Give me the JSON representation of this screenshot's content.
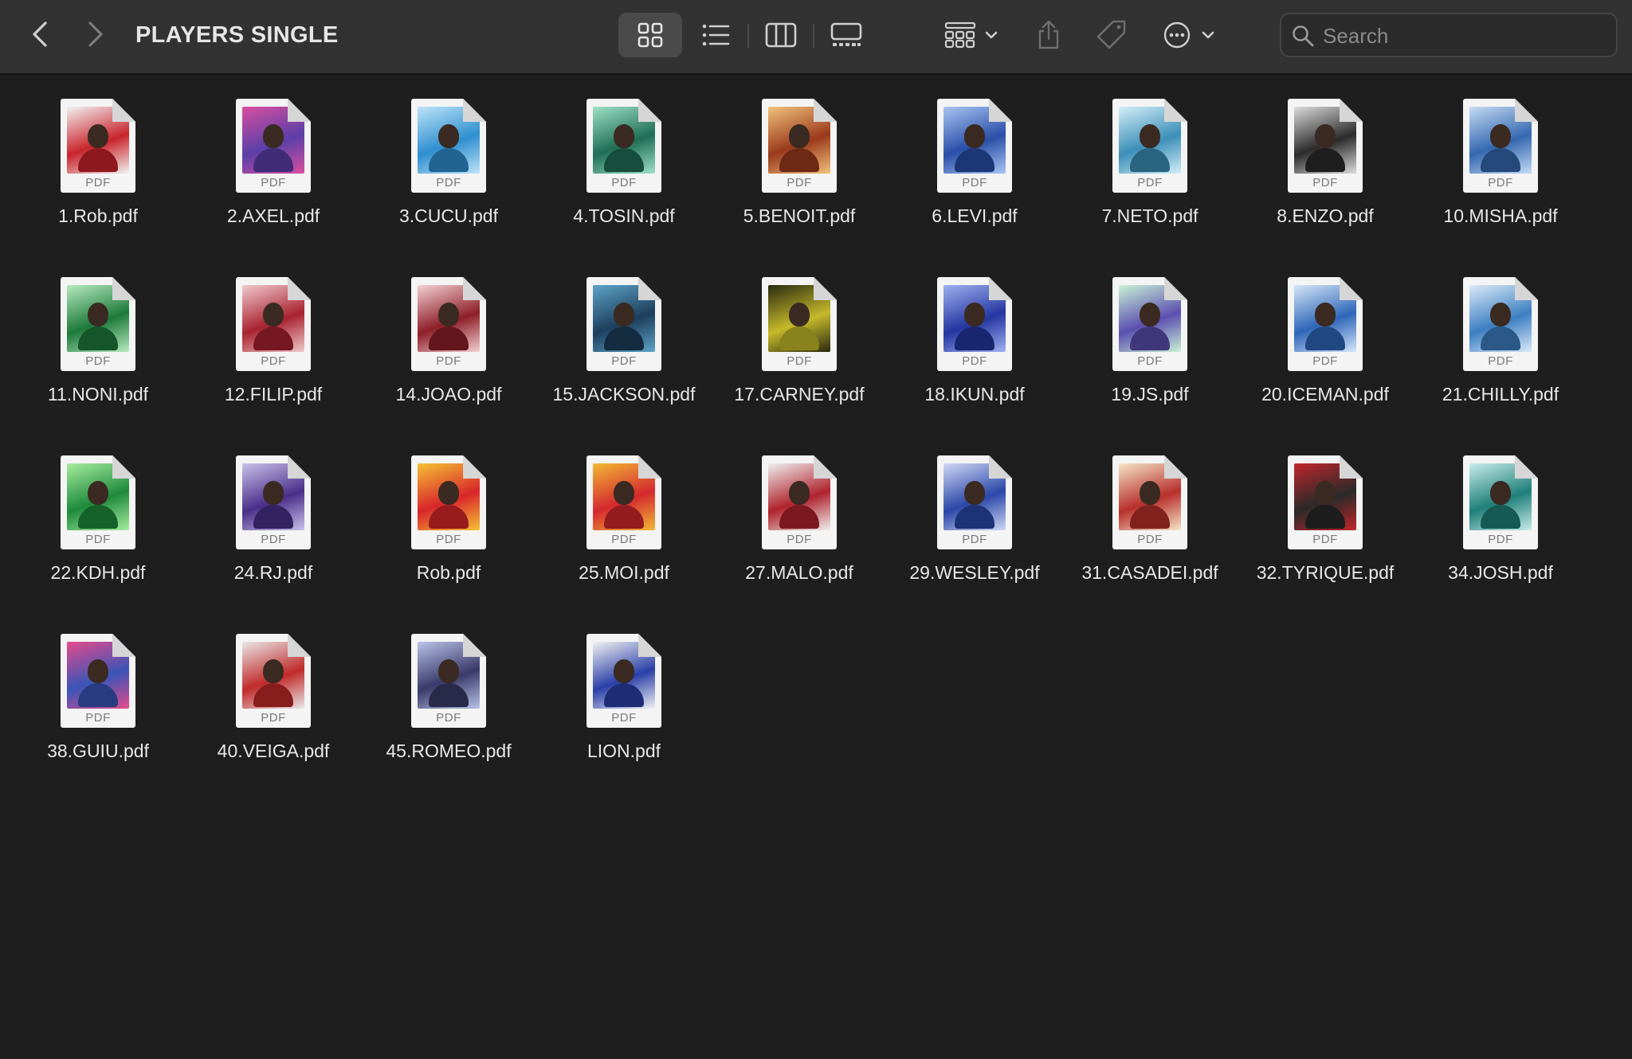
{
  "window": {
    "title": "PLAYERS SINGLE"
  },
  "toolbar": {
    "back_icon": "chevron-left-icon",
    "forward_icon": "chevron-right-icon",
    "views": [
      {
        "name": "icons",
        "icon": "grid-view-icon",
        "active": true
      },
      {
        "name": "list",
        "icon": "list-view-icon",
        "active": false
      },
      {
        "name": "columns",
        "icon": "column-view-icon",
        "active": false
      },
      {
        "name": "gallery",
        "icon": "gallery-view-icon",
        "active": false
      }
    ],
    "group_icon": "group-by-icon",
    "share_icon": "share-icon",
    "tag_icon": "tag-icon",
    "more_icon": "ellipsis-circle-icon"
  },
  "search": {
    "placeholder": "Search",
    "value": ""
  },
  "colors": {
    "toolbar_bg": "#323233",
    "window_bg": "#1e1e1e",
    "text": "#e8e8e8"
  },
  "files": [
    {
      "name": "1.Rob.pdf",
      "type": "PDF",
      "poster": [
        "#c9242b",
        "#f2f2f2"
      ]
    },
    {
      "name": "2.AXEL.pdf",
      "type": "PDF",
      "poster": [
        "#5b3fa8",
        "#d94fa0"
      ]
    },
    {
      "name": "3.CUCU.pdf",
      "type": "PDF",
      "poster": [
        "#2f8fd0",
        "#bde3f7"
      ]
    },
    {
      "name": "4.TOSIN.pdf",
      "type": "PDF",
      "poster": [
        "#1f6e55",
        "#9fe0c8"
      ]
    },
    {
      "name": "5.BENOIT.pdf",
      "type": "PDF",
      "poster": [
        "#9b3a1c",
        "#f0c27a"
      ]
    },
    {
      "name": "6.LEVI.pdf",
      "type": "PDF",
      "poster": [
        "#2a4fa8",
        "#a9c4f2"
      ]
    },
    {
      "name": "7.NETO.pdf",
      "type": "PDF",
      "poster": [
        "#3c8fb8",
        "#d3eef8"
      ]
    },
    {
      "name": "8.ENZO.pdf",
      "type": "PDF",
      "poster": [
        "#2b2b2b",
        "#dcdcdc"
      ]
    },
    {
      "name": "10.MISHA.pdf",
      "type": "PDF",
      "poster": [
        "#3568b0",
        "#c4dbf3"
      ]
    },
    {
      "name": "11.NONI.pdf",
      "type": "PDF",
      "poster": [
        "#1d7a3a",
        "#b7eabf"
      ]
    },
    {
      "name": "12.FILIP.pdf",
      "type": "PDF",
      "poster": [
        "#a82330",
        "#f1c9cc"
      ]
    },
    {
      "name": "14.JOAO.pdf",
      "type": "PDF",
      "poster": [
        "#8e1f28",
        "#f3d0d3"
      ]
    },
    {
      "name": "15.JACKSON.pdf",
      "type": "PDF",
      "poster": [
        "#1d3f5c",
        "#5ea3c9"
      ]
    },
    {
      "name": "17.CARNEY.pdf",
      "type": "PDF",
      "poster": [
        "#c5b92a",
        "#2a2a10"
      ]
    },
    {
      "name": "18.IKUN.pdf",
      "type": "PDF",
      "poster": [
        "#2436a0",
        "#9fb0f0"
      ]
    },
    {
      "name": "19.JS.pdf",
      "type": "PDF",
      "poster": [
        "#5b4fb0",
        "#c9f2d6"
      ]
    },
    {
      "name": "20.ICEMAN.pdf",
      "type": "PDF",
      "poster": [
        "#2f66b8",
        "#d5e6f8"
      ]
    },
    {
      "name": "21.CHILLY.pdf",
      "type": "PDF",
      "poster": [
        "#3c7fc2",
        "#dbeaf7"
      ]
    },
    {
      "name": "22.KDH.pdf",
      "type": "PDF",
      "poster": [
        "#1f8a3c",
        "#a6ed9e"
      ]
    },
    {
      "name": "24.RJ.pdf",
      "type": "PDF",
      "poster": [
        "#4a2f8a",
        "#c9c1ea"
      ]
    },
    {
      "name": "Rob.pdf",
      "type": "PDF",
      "poster": [
        "#d9262b",
        "#f4c133"
      ]
    },
    {
      "name": "25.MOI.pdf",
      "type": "PDF",
      "poster": [
        "#d4282e",
        "#f2b935"
      ]
    },
    {
      "name": "27.MALO.pdf",
      "type": "PDF",
      "poster": [
        "#b0232d",
        "#efefef"
      ]
    },
    {
      "name": "29.WESLEY.pdf",
      "type": "PDF",
      "poster": [
        "#2b47a8",
        "#cfd8f5"
      ]
    },
    {
      "name": "31.CASADEI.pdf",
      "type": "PDF",
      "poster": [
        "#b8302c",
        "#f5e5c8"
      ]
    },
    {
      "name": "32.TYRIQUE.pdf",
      "type": "PDF",
      "poster": [
        "#2a2a2a",
        "#c0262c"
      ]
    },
    {
      "name": "34.JOSH.pdf",
      "type": "PDF",
      "poster": [
        "#1f7f7a",
        "#c8ecea"
      ]
    },
    {
      "name": "38.GUIU.pdf",
      "type": "PDF",
      "poster": [
        "#3a55b8",
        "#e64a8c"
      ]
    },
    {
      "name": "40.VEIGA.pdf",
      "type": "PDF",
      "poster": [
        "#c22a2a",
        "#e8e8e8"
      ]
    },
    {
      "name": "45.ROMEO.pdf",
      "type": "PDF",
      "poster": [
        "#3a3a6a",
        "#b9c3e8"
      ]
    },
    {
      "name": "LION.pdf",
      "type": "PDF",
      "poster": [
        "#2a3fa8",
        "#f2f2f2"
      ]
    }
  ]
}
